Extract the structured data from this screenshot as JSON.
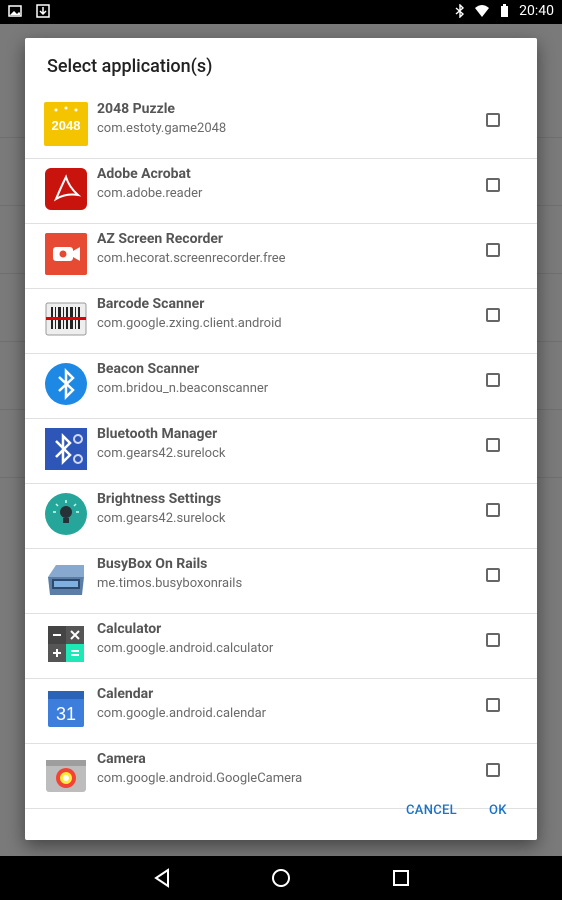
{
  "status_bar": {
    "time": "20:40"
  },
  "dialog": {
    "title": "Select application(s)",
    "items": [
      {
        "name": "2048 Puzzle",
        "package": "com.estoty.game2048",
        "icon": "puzzle-2048-icon",
        "checked": false
      },
      {
        "name": "Adobe Acrobat",
        "package": "com.adobe.reader",
        "icon": "adobe-acrobat-icon",
        "checked": false
      },
      {
        "name": "AZ Screen Recorder",
        "package": "com.hecorat.screenrecorder.free",
        "icon": "screen-recorder-icon",
        "checked": false
      },
      {
        "name": "Barcode Scanner",
        "package": "com.google.zxing.client.android",
        "icon": "barcode-scanner-icon",
        "checked": false
      },
      {
        "name": "Beacon Scanner",
        "package": "com.bridou_n.beaconscanner",
        "icon": "bluetooth-beacon-icon",
        "checked": false
      },
      {
        "name": "Bluetooth Manager",
        "package": "com.gears42.surelock",
        "icon": "bluetooth-manager-icon",
        "checked": false
      },
      {
        "name": "Brightness Settings",
        "package": "com.gears42.surelock",
        "icon": "brightness-icon",
        "checked": false
      },
      {
        "name": "BusyBox On Rails",
        "package": "me.timos.busyboxonrails",
        "icon": "toolbox-icon",
        "checked": false
      },
      {
        "name": "Calculator",
        "package": "com.google.android.calculator",
        "icon": "calculator-icon",
        "checked": false
      },
      {
        "name": "Calendar",
        "package": "com.google.android.calendar",
        "icon": "calendar-icon",
        "checked": false
      },
      {
        "name": "Camera",
        "package": "com.google.android.GoogleCamera",
        "icon": "camera-icon",
        "checked": false
      }
    ],
    "cancel_label": "CANCEL",
    "ok_label": "OK",
    "calendar_day": "31",
    "game_label": "2048"
  },
  "colors": {
    "accent": "#1a73c9"
  }
}
